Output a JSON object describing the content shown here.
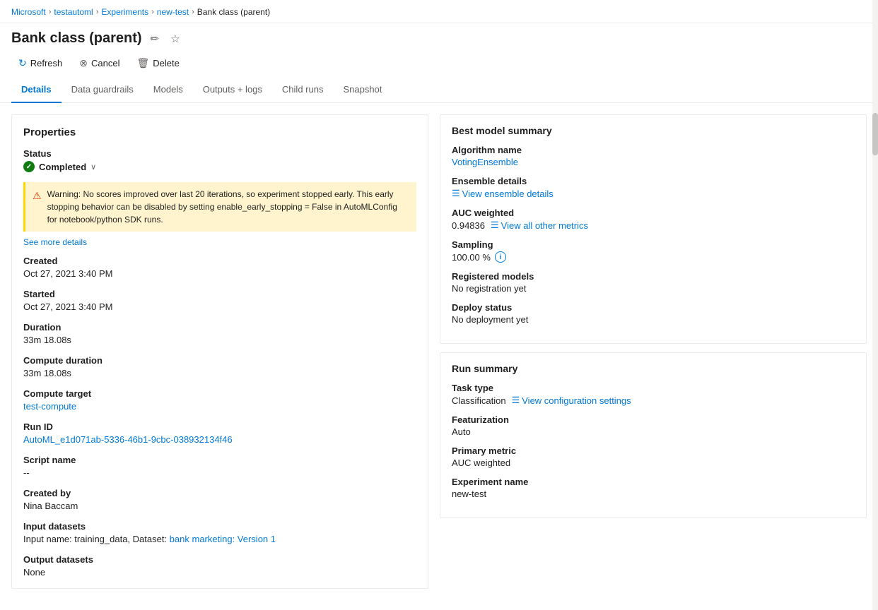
{
  "breadcrumb": {
    "items": [
      {
        "label": "Microsoft",
        "link": true
      },
      {
        "label": "testautoml",
        "link": true
      },
      {
        "label": "Experiments",
        "link": true
      },
      {
        "label": "new-test",
        "link": true
      },
      {
        "label": "Bank class (parent)",
        "link": false
      }
    ]
  },
  "page": {
    "title": "Bank class (parent)",
    "edit_icon": "✏",
    "star_icon": "☆"
  },
  "toolbar": {
    "refresh_label": "Refresh",
    "cancel_label": "Cancel",
    "delete_label": "Delete"
  },
  "tabs": [
    {
      "label": "Details",
      "active": true
    },
    {
      "label": "Data guardrails",
      "active": false
    },
    {
      "label": "Models",
      "active": false
    },
    {
      "label": "Outputs + logs",
      "active": false
    },
    {
      "label": "Child runs",
      "active": false
    },
    {
      "label": "Snapshot",
      "active": false
    }
  ],
  "properties": {
    "title": "Properties",
    "status_label": "Status",
    "status_value": "Completed",
    "warning_text": "Warning: No scores improved over last 20 iterations, so experiment stopped early. This early stopping behavior can be disabled by setting enable_early_stopping = False in AutoMLConfig for notebook/python SDK runs.",
    "see_more": "See more details",
    "created_label": "Created",
    "created_value": "Oct 27, 2021 3:40 PM",
    "started_label": "Started",
    "started_value": "Oct 27, 2021 3:40 PM",
    "duration_label": "Duration",
    "duration_value": "33m 18.08s",
    "compute_duration_label": "Compute duration",
    "compute_duration_value": "33m 18.08s",
    "compute_target_label": "Compute target",
    "compute_target_value": "test-compute",
    "run_id_label": "Run ID",
    "run_id_value": "AutoML_e1d071ab-5336-46b1-9cbc-038932134f46",
    "script_name_label": "Script name",
    "script_name_value": "--",
    "created_by_label": "Created by",
    "created_by_value": "Nina Baccam",
    "input_datasets_label": "Input datasets",
    "input_datasets_prefix": "Input name: training_data, Dataset: ",
    "input_datasets_link": "bank marketing: Version 1",
    "output_datasets_label": "Output datasets",
    "output_datasets_value": "None"
  },
  "best_model_summary": {
    "title": "Best model summary",
    "algorithm_label": "Algorithm name",
    "algorithm_value": "VotingEnsemble",
    "ensemble_label": "Ensemble details",
    "ensemble_link": "View ensemble details",
    "auc_label": "AUC weighted",
    "auc_value": "0.94836",
    "view_metrics_link": "View all other metrics",
    "sampling_label": "Sampling",
    "sampling_value": "100.00 %",
    "registered_models_label": "Registered models",
    "registered_models_value": "No registration yet",
    "deploy_status_label": "Deploy status",
    "deploy_status_value": "No deployment yet"
  },
  "run_summary": {
    "title": "Run summary",
    "task_type_label": "Task type",
    "task_type_value": "Classification",
    "config_link": "View configuration settings",
    "featurization_label": "Featurization",
    "featurization_value": "Auto",
    "primary_metric_label": "Primary metric",
    "primary_metric_value": "AUC weighted",
    "experiment_name_label": "Experiment name",
    "experiment_name_value": "new-test"
  }
}
